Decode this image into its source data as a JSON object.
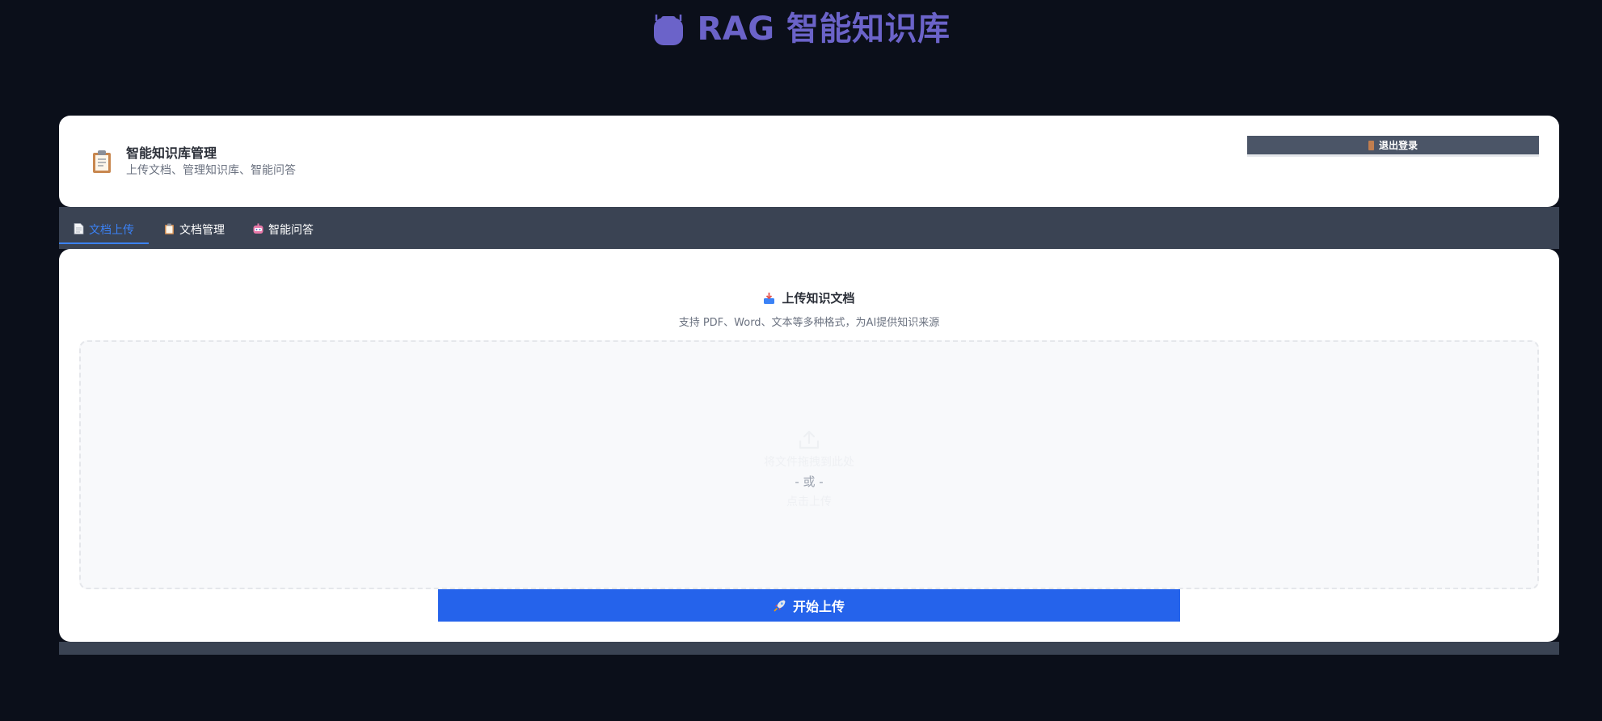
{
  "app": {
    "title": "RAG 智能知识库"
  },
  "header": {
    "title": "智能知识库管理",
    "subtitle": "上传文档、管理知识库、智能问答",
    "logout_label": "退出登录"
  },
  "tabs": [
    {
      "label": "文档上传",
      "active": true,
      "icon": "document-icon"
    },
    {
      "label": "文档管理",
      "active": false,
      "icon": "clipboard-icon"
    },
    {
      "label": "智能问答",
      "active": false,
      "icon": "robot-icon"
    }
  ],
  "upload": {
    "heading": "上传知识文档",
    "description": "支持 PDF、Word、文本等多种格式，为AI提供知识来源",
    "drop_hint": "将文件拖拽到此处",
    "or_text": "- 或 -",
    "click_upload": "点击上传",
    "start_button": "开始上传"
  },
  "colors": {
    "background": "#0b0f1a",
    "title_accent": "#6b63c9",
    "active_tab": "#3b82f6",
    "primary_button": "#2563eb",
    "tab_strip": "#3a4353",
    "logout_button": "#4b5567"
  }
}
